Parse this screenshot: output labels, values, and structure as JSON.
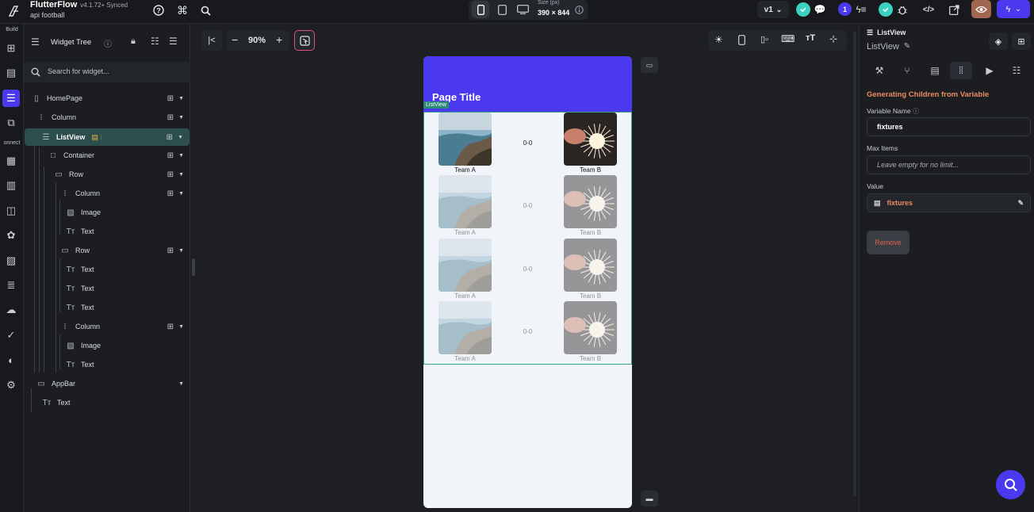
{
  "app": {
    "name": "FlutterFlow",
    "version": "v4.1.72+ Synced",
    "project": "api football",
    "size_label": "Size (px)",
    "size_value": "390 × 844",
    "zoom": "90%",
    "version_select": "v1",
    "notif_count": "1"
  },
  "rail": {
    "build_label": "Build",
    "connect_label": "onnect"
  },
  "tree": {
    "title": "Widget Tree",
    "search_placeholder": "Search for widget...",
    "items": [
      {
        "label": "HomePage",
        "icon": "phone-icon"
      },
      {
        "label": "Column",
        "icon": "column-icon"
      },
      {
        "label": "ListView",
        "icon": "listview-icon"
      },
      {
        "label": "Container",
        "icon": "container-icon"
      },
      {
        "label": "Row",
        "icon": "row-icon"
      },
      {
        "label": "Column",
        "icon": "column-icon"
      },
      {
        "label": "Image",
        "icon": "image-icon"
      },
      {
        "label": "Text",
        "icon": "text-icon"
      },
      {
        "label": "Row",
        "icon": "row-icon"
      },
      {
        "label": "Text",
        "icon": "text-icon"
      },
      {
        "label": "Text",
        "icon": "text-icon"
      },
      {
        "label": "Text",
        "icon": "text-icon"
      },
      {
        "label": "Column",
        "icon": "column-icon"
      },
      {
        "label": "Image",
        "icon": "image-icon"
      },
      {
        "label": "Text",
        "icon": "text-icon"
      },
      {
        "label": "AppBar",
        "icon": "appbar-icon"
      },
      {
        "label": "Text",
        "icon": "text-icon"
      }
    ]
  },
  "canvas": {
    "page_title": "Page Title",
    "listview_tag": "ListView",
    "fixtures": [
      {
        "team_a": "Team A",
        "score": "0-0",
        "team_b": "Team B"
      },
      {
        "team_a": "Team A",
        "score": "0-0",
        "team_b": "Team B"
      },
      {
        "team_a": "Team A",
        "score": "0-0",
        "team_b": "Team B"
      },
      {
        "team_a": "Team A",
        "score": "0-0",
        "team_b": "Team B"
      }
    ]
  },
  "props": {
    "widget_type": "ListView",
    "widget_name": "ListView",
    "section_title": "Generating Children from Variable",
    "variable_name_label": "Variable Name",
    "variable_name_value": "fixtures",
    "max_items_label": "Max Items",
    "max_items_placeholder": "Leave empty for no limit...",
    "value_label": "Value",
    "value_value": "fixtures",
    "remove_label": "Remove"
  },
  "colors": {
    "accent": "#4b39ef",
    "highlight_orange": "#ee8b60",
    "selection": "#2c4f4d",
    "listview_border": "#3aa58f"
  }
}
